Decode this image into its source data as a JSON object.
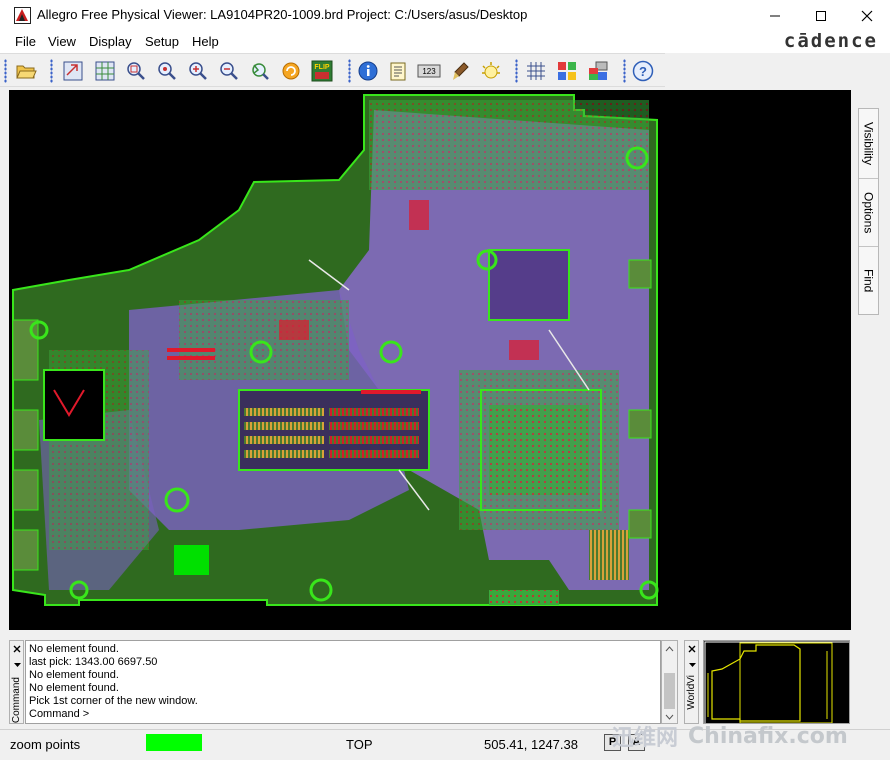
{
  "window": {
    "title": "Allegro Free Physical Viewer: LA9104PR20-1009.brd  Project: C:/Users/asus/Desktop",
    "controls": [
      "minimize",
      "maximize",
      "close"
    ]
  },
  "menu": {
    "items": [
      "File",
      "View",
      "Display",
      "Setup",
      "Help"
    ],
    "brand": "cādence"
  },
  "toolbar": {
    "buttons": [
      {
        "icon": "open-folder-icon"
      },
      {
        "icon": "zoom-window-icon"
      },
      {
        "icon": "zoom-grid-icon"
      },
      {
        "icon": "zoom-fit-icon"
      },
      {
        "icon": "zoom-in-icon"
      },
      {
        "icon": "zoom-plus-icon"
      },
      {
        "icon": "zoom-minus-icon"
      },
      {
        "icon": "zoom-previous-icon"
      },
      {
        "icon": "redraw-icon"
      },
      {
        "icon": "flip-icon",
        "label": "FLIP"
      },
      {
        "icon": "info-icon"
      },
      {
        "icon": "report-icon"
      },
      {
        "icon": "measure-icon",
        "label": "123"
      },
      {
        "icon": "brush-icon"
      },
      {
        "icon": "highlight-icon"
      },
      {
        "icon": "grid-icon"
      },
      {
        "icon": "color-icon"
      },
      {
        "icon": "layer-icon"
      },
      {
        "icon": "help-icon"
      }
    ]
  },
  "right_tabs": [
    "Visibility",
    "Options",
    "Find"
  ],
  "command": {
    "label": "Command",
    "lines": [
      "No element found.",
      "last pick:  1343.00  6697.50",
      "No element found.",
      "No element found.",
      "Pick 1st corner of the new window.",
      "Command >"
    ]
  },
  "worldview": {
    "label": "WorldVi"
  },
  "status": {
    "mode": "zoom points",
    "indicator_color": "#00ff00",
    "layer": "TOP",
    "coords": "505.41, 1247.38",
    "p_label": "P",
    "a_label": "A"
  },
  "watermark": {
    "logo": "迅维网",
    "site": "Chinafix.com"
  },
  "colors": {
    "board_outline": "#39e61b",
    "copper_pour": "#9b72d6",
    "pads": "#e0192b",
    "traces": "#d8a13a"
  }
}
